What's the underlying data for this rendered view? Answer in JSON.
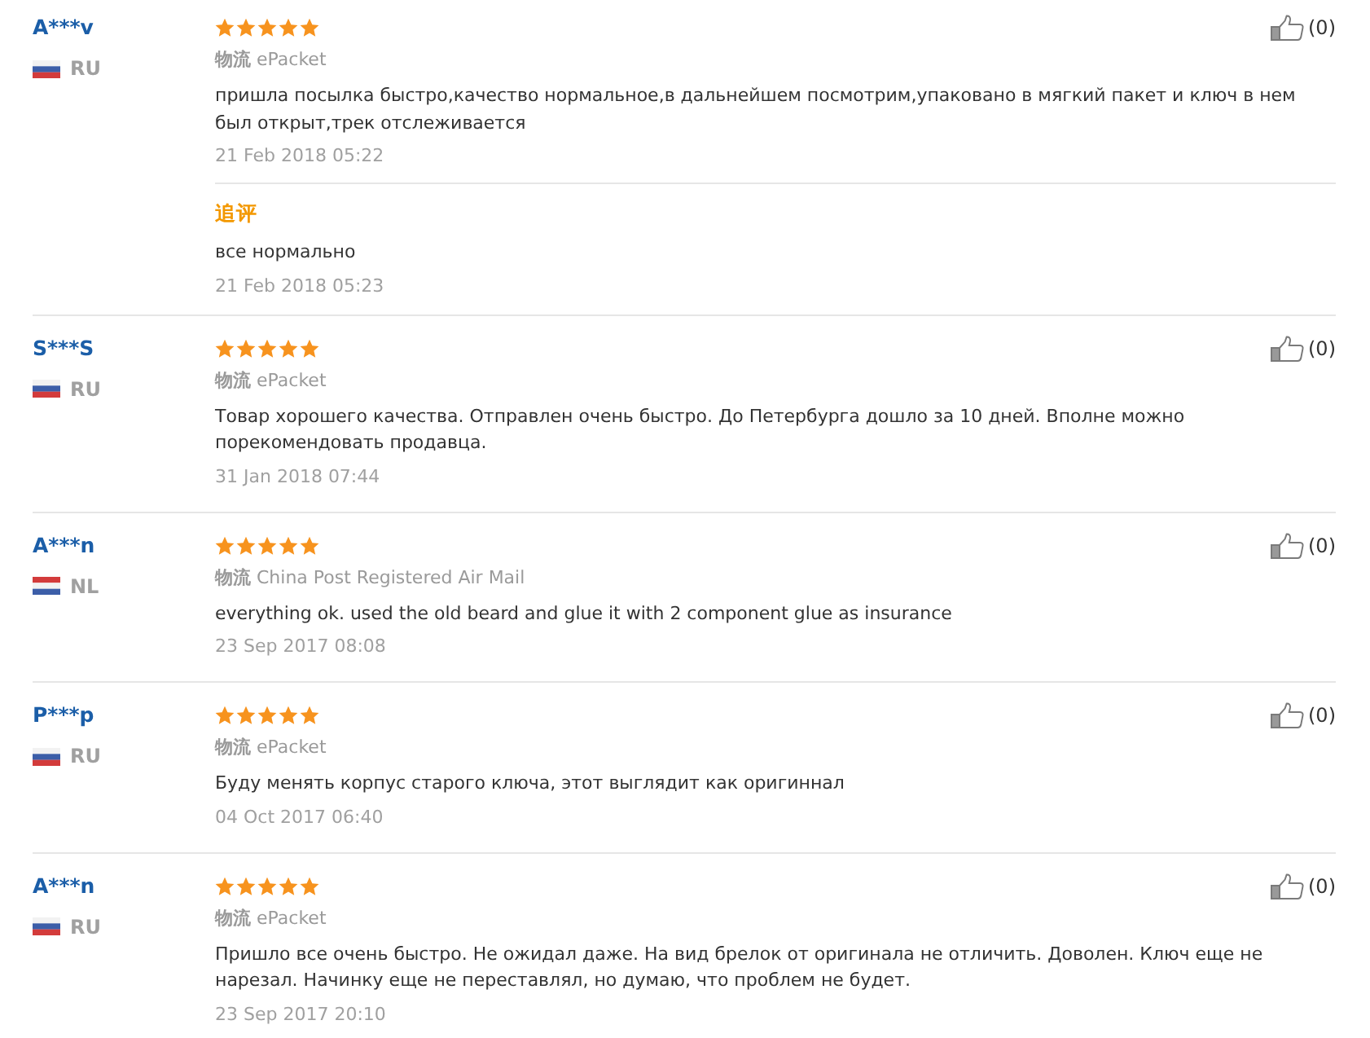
{
  "reviews": [
    {
      "user": "A***v",
      "country": "RU",
      "flag": {
        "kind": "russia"
      },
      "stars": 5,
      "likes": "(0)",
      "shipping": "**物流** ePacket",
      "text": "пришла посылка быстро,качество нормальное,в дальнейшем посмотрим,упаковано в мягкий пакет и ключ в нем был открыт,трек отслеживается",
      "date": "21 Feb 2018 05:22",
      "follow_up": {
        "label": "追评",
        "text": "все нормально",
        "date": "21 Feb 2018 05:23"
      }
    },
    {
      "user": "S***S",
      "country": "RU",
      "flag": {
        "kind": "russia"
      },
      "stars": 5,
      "likes": "(0)",
      "shipping": "**物流** ePacket",
      "text": "Товар хорошего качества. Отправлен очень быстро. До Петербурга дошло за 10 дней. Вполне можно порекомендовать продавца.",
      "date": "31 Jan 2018 07:44"
    },
    {
      "user": "A***n",
      "country": "NL",
      "flag": {
        "kind": "netherlands"
      },
      "stars": 5,
      "likes": "(0)",
      "shipping": "**物流** China Post Registered Air Mail",
      "text": "everything ok. used the old beard and glue it with 2 component glue as insurance",
      "date": "23 Sep 2017 08:08"
    },
    {
      "user": "P***p",
      "country": "RU",
      "flag": {
        "kind": "russia"
      },
      "stars": 5,
      "likes": "(0)",
      "shipping": "**物流** ePacket",
      "text": "Буду менять корпус старого ключа, этот выглядит как оригиннал",
      "date": "04 Oct 2017 06:40"
    },
    {
      "user": "A***n",
      "country": "RU",
      "flag": {
        "kind": "russia"
      },
      "stars": 5,
      "likes": "(0)",
      "shipping": "**物流** ePacket",
      "text": "Пришло все очень быстро. Не ожидал даже. На вид брелок от оригинала не отличить. Доволен. Ключ еще не нарезал. Начинку еще не переставлял, но думаю, что проблем не будет.",
      "date": "23 Sep 2017 20:10"
    }
  ]
}
